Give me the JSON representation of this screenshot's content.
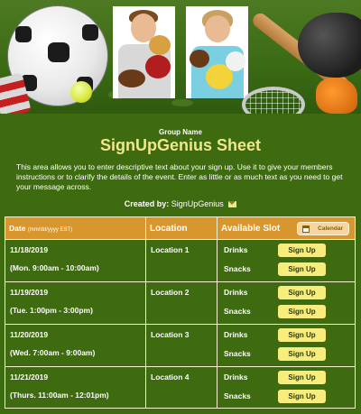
{
  "header": {
    "group_name": "Group Name",
    "title": "SignUpGenius Sheet",
    "description": "This area allows you to enter descriptive text about your sign up. Use it to give your members instructions or to clarify the details of the event. Enter as little or as much text as you need to get your message across.",
    "created_by_label": "Created by:",
    "created_by_name": "SignUpGenius"
  },
  "table": {
    "col_date": "Date",
    "col_date_format": "(mm/dd/yyyy EST)",
    "col_location": "Location",
    "col_slot": "Available Slot",
    "calendar_label": "Calendar",
    "signup_label": "Sign Up",
    "rows": [
      {
        "date": "11/18/2019",
        "time": "(Mon. 9:00am - 10:00am)",
        "location": "Location 1",
        "slots": [
          "Drinks",
          "Snacks"
        ]
      },
      {
        "date": "11/19/2019",
        "time": "(Tue. 1:00pm - 3:00pm)",
        "location": "Location 2",
        "slots": [
          "Drinks",
          "Snacks"
        ]
      },
      {
        "date": "11/20/2019",
        "time": "(Wed. 7:00am - 9:00am)",
        "location": "Location 3",
        "slots": [
          "Drinks",
          "Snacks"
        ]
      },
      {
        "date": "11/21/2019",
        "time": "(Thurs. 11:00am - 12:01pm)",
        "location": "Location 4",
        "slots": [
          "Drinks",
          "Snacks"
        ]
      }
    ]
  },
  "colors": {
    "background": "#3e6b10",
    "title": "#f0e68c",
    "table_header": "#d8962f",
    "button": "#f7ec7c"
  },
  "icons": {
    "banner": "sports-equipment-banner",
    "mail": "mail-icon",
    "calendar": "calendar-icon"
  }
}
